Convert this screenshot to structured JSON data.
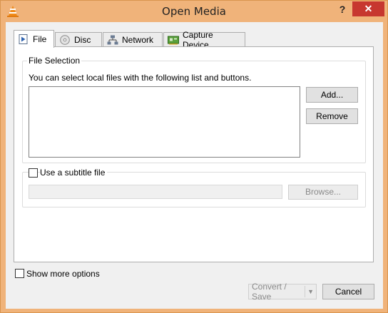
{
  "window": {
    "title": "Open Media",
    "help_label": "?",
    "close_label": "✕",
    "accent": "#f0b37a",
    "close_color": "#c7372f"
  },
  "tabs": [
    {
      "label": "File",
      "icon": "file-play-icon",
      "active": true
    },
    {
      "label": "Disc",
      "icon": "disc-icon",
      "active": false
    },
    {
      "label": "Network",
      "icon": "network-icon",
      "active": false
    },
    {
      "label": "Capture Device",
      "icon": "capture-card-icon",
      "active": false
    }
  ],
  "file_selection": {
    "group_label": "File Selection",
    "description": "You can select local files with the following list and buttons.",
    "add_label": "Add...",
    "remove_label": "Remove"
  },
  "subtitle": {
    "checkbox_label": "Use a subtitle file",
    "checked": false,
    "browse_label": "Browse..."
  },
  "footer": {
    "show_more_label": "Show more options",
    "show_more_checked": false,
    "convert_label": "Convert / Save",
    "dropdown_arrow": "▼",
    "cancel_label": "Cancel"
  }
}
